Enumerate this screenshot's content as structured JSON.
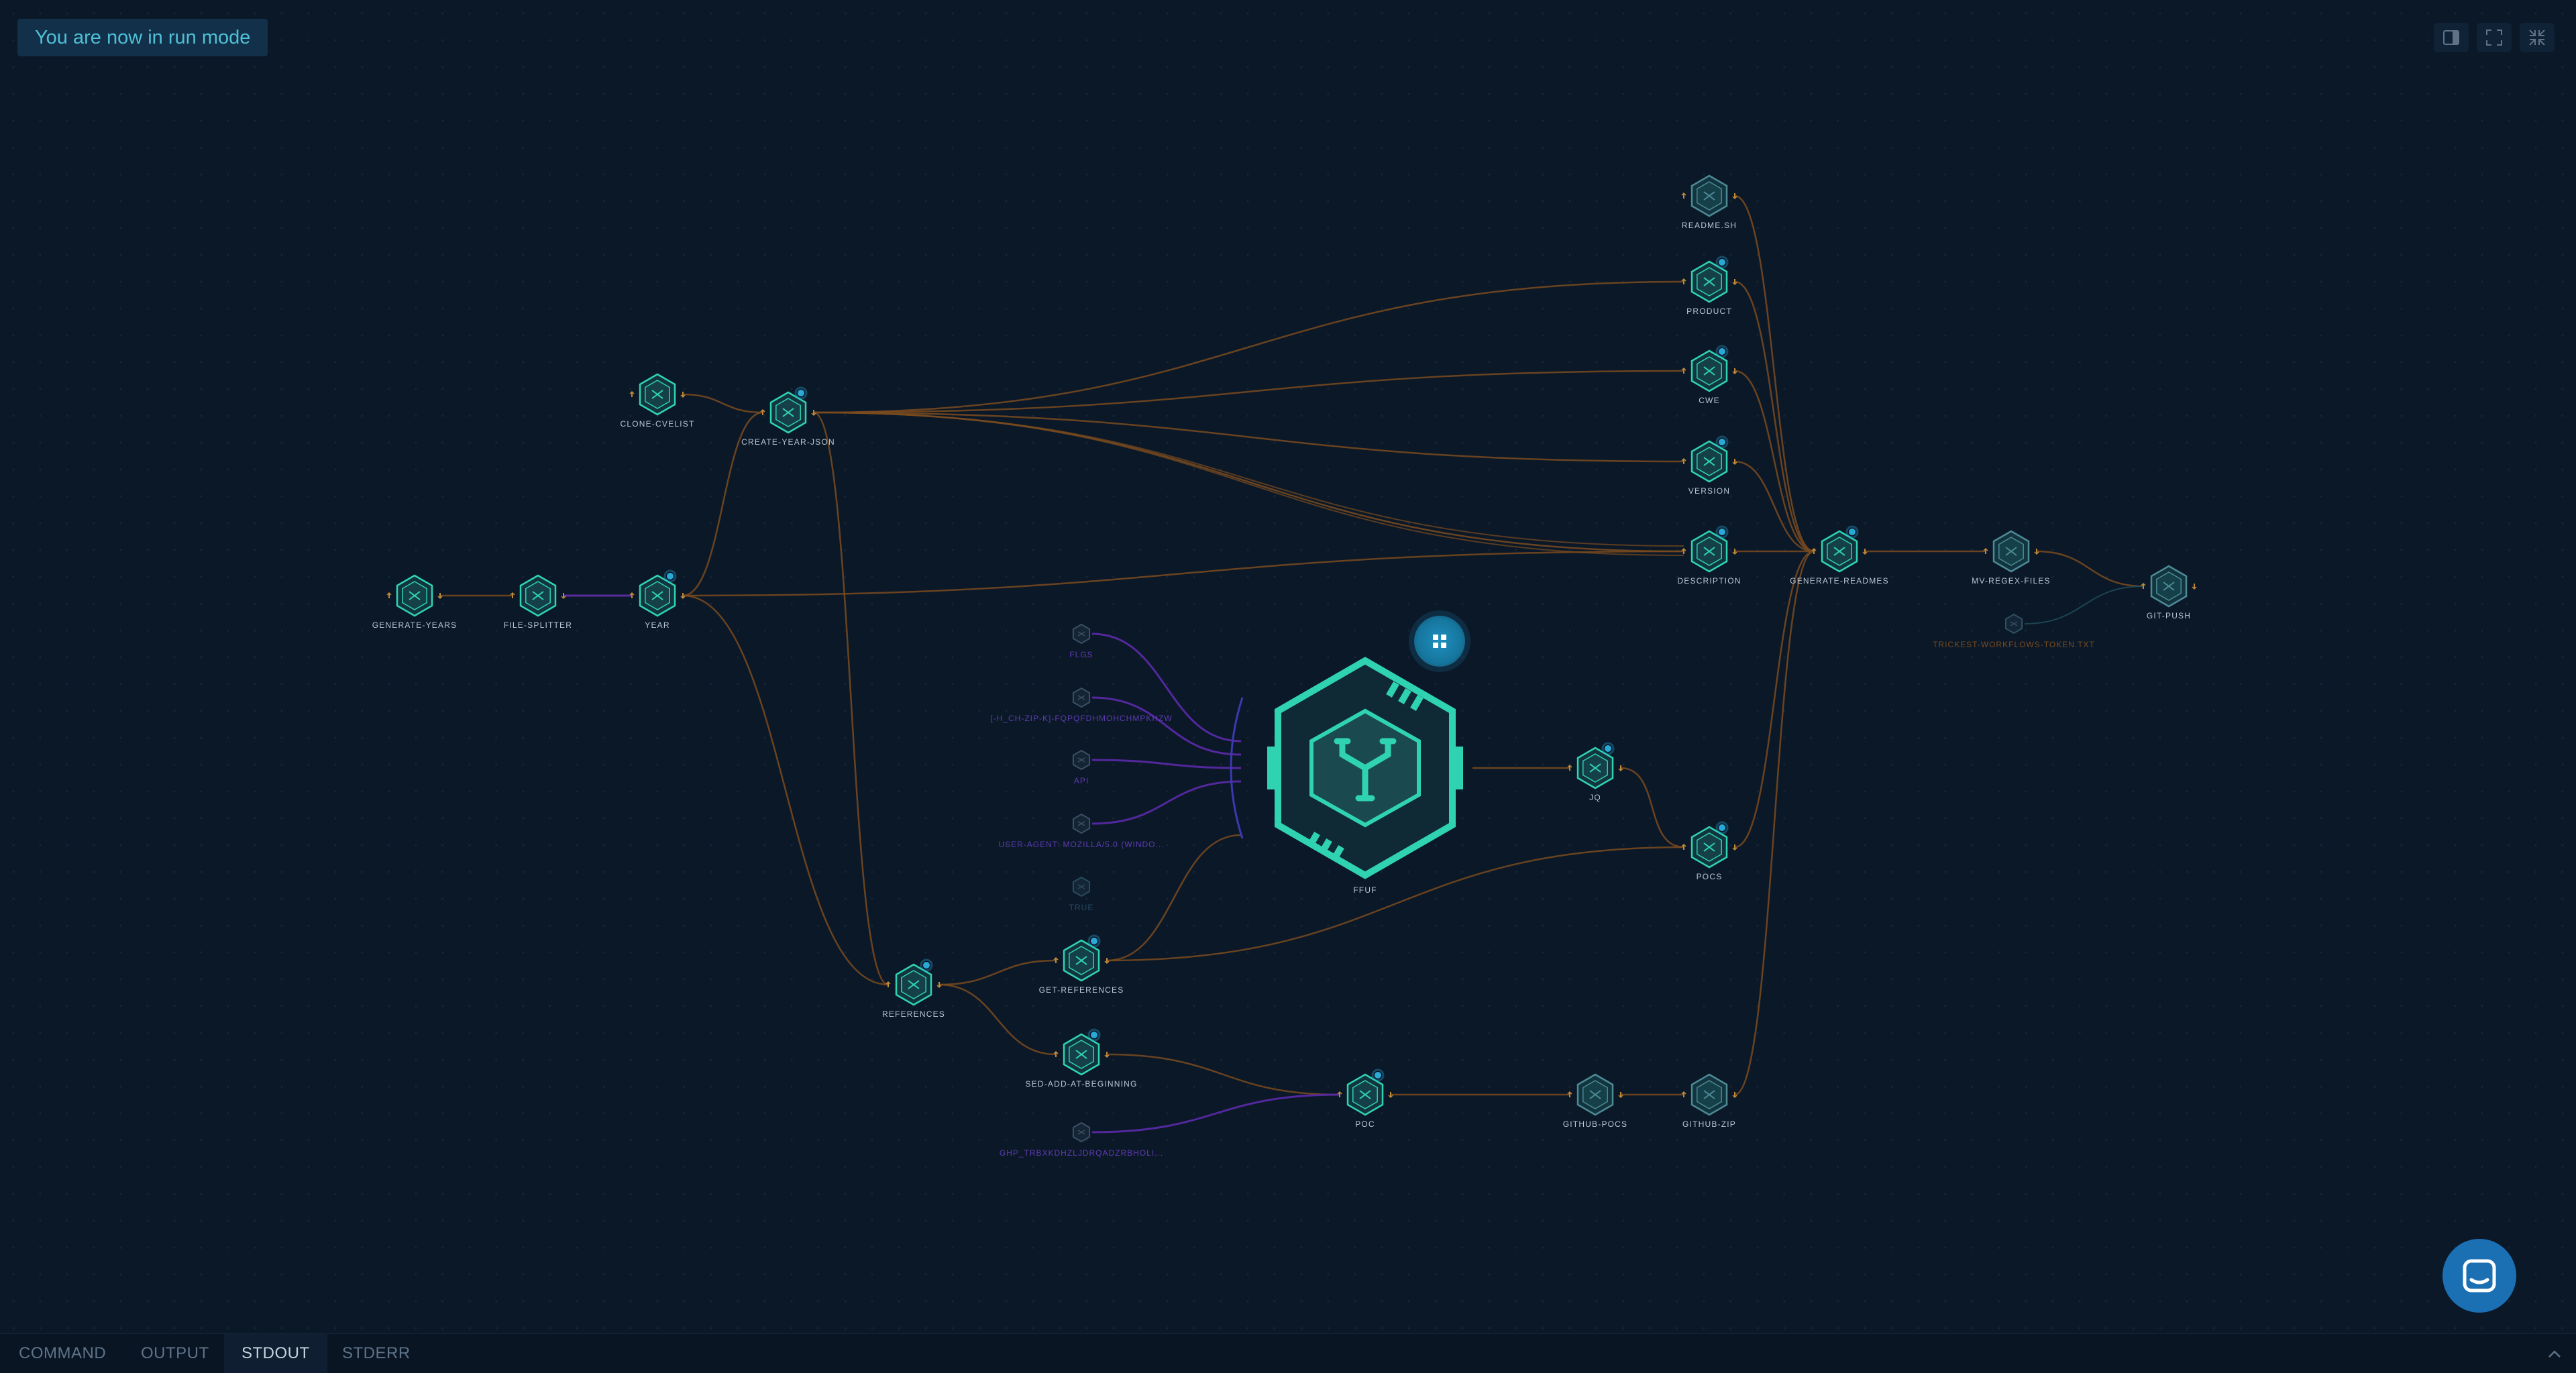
{
  "banner": {
    "text": "You are now in run mode"
  },
  "toolbar": {
    "icons": [
      "sidebar-toggle-icon",
      "fullscreen-icon",
      "collapse-icon"
    ]
  },
  "colors": {
    "background": "#0b1828",
    "node_stroke": "#2fd3b2",
    "node_fill": "#12343f",
    "edge_orange": "#7a4b1e",
    "edge_purple": "#5b2aa8",
    "status_dot": "#2aa9d6",
    "chat_button": "#1b6fb3"
  },
  "nodes": [
    {
      "id": "generate-years",
      "label": "GENERATE-YEARS"
    },
    {
      "id": "file-splitter",
      "label": "FILE-SPLITTER"
    },
    {
      "id": "year",
      "label": "YEAR"
    },
    {
      "id": "clone-cvelist",
      "label": "CLONE-CVELIST"
    },
    {
      "id": "create-year-json",
      "label": "CREATE-YEAR-JSON"
    },
    {
      "id": "readme-sh",
      "label": "README.SH"
    },
    {
      "id": "product",
      "label": "PRODUCT"
    },
    {
      "id": "cwe",
      "label": "CWE"
    },
    {
      "id": "version",
      "label": "VERSION"
    },
    {
      "id": "description",
      "label": "DESCRIPTION"
    },
    {
      "id": "generate-readmes",
      "label": "GENERATE-READMES"
    },
    {
      "id": "mv-regex-files",
      "label": "MV-REGEX-FILES"
    },
    {
      "id": "git-push",
      "label": "GIT-PUSH"
    },
    {
      "id": "jq",
      "label": "JQ"
    },
    {
      "id": "pocs",
      "label": "POCS"
    },
    {
      "id": "references",
      "label": "REFERENCES"
    },
    {
      "id": "get-references",
      "label": "GET-REFERENCES"
    },
    {
      "id": "sed-add-at-beginning",
      "label": "SED-ADD-AT-BEGINNING"
    },
    {
      "id": "poc",
      "label": "POC"
    },
    {
      "id": "github-pocs",
      "label": "GITHUB-POCS"
    },
    {
      "id": "github-zip",
      "label": "GITHUB-ZIP"
    }
  ],
  "hub": {
    "label": "FFUF"
  },
  "params": [
    {
      "id": "p-flags",
      "label": "FLGS"
    },
    {
      "id": "p-h",
      "label": "[-H_CH-ZIP-K]-FQPQFDHMOHCHMPKHZW"
    },
    {
      "id": "p-api",
      "label": "API"
    },
    {
      "id": "p-ua",
      "label": "USER-AGENT: MOZILLA/5.0 (WINDO..."
    },
    {
      "id": "p-fade",
      "label": "TRUE"
    },
    {
      "id": "p-git",
      "label": "GHP_TRBXKDHZLJDRQADZRBHOLI..."
    },
    {
      "id": "p-token",
      "label": "TRICKEST-WORKFLOWS-TOKEN.TXT"
    }
  ],
  "bottom_tabs": [
    "COMMAND",
    "OUTPUT",
    "STDOUT",
    "STDERR"
  ],
  "active_tab": "STDOUT"
}
